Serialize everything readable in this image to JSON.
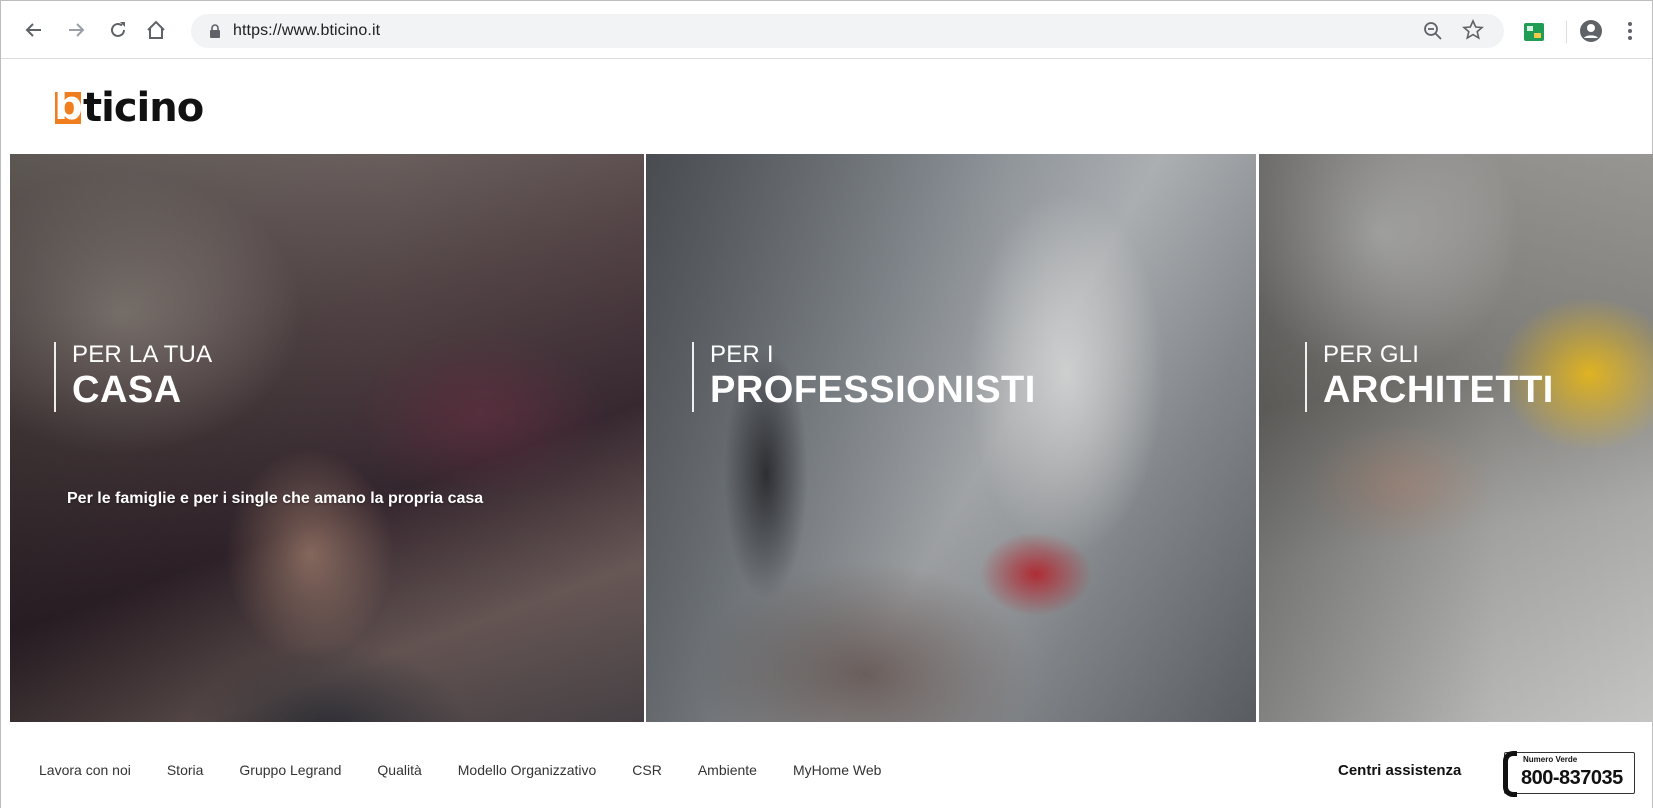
{
  "browser": {
    "url": "https://www.bticino.it",
    "icons": {
      "back": "arrow-left-icon",
      "forward": "arrow-right-icon",
      "reload": "reload-icon",
      "home": "home-icon",
      "lock": "lock-icon",
      "zoom": "zoom-icon",
      "bookmark": "star-icon",
      "extension": "extension-icon",
      "profile": "account-icon",
      "menu": "kebab-menu-icon"
    }
  },
  "site": {
    "logo_b": "b",
    "logo_rest": "ticino",
    "brand_color": "#f07d1e"
  },
  "hero": {
    "panels": [
      {
        "small": "PER LA TUA",
        "big": "CASA",
        "description": "Per le famiglie e per i single che amano la propria casa"
      },
      {
        "small": "PER I",
        "big": "PROFESSIONISTI"
      },
      {
        "small": "PER GLI",
        "big": "ARCHITETTI"
      }
    ]
  },
  "footer": {
    "links": [
      "Lavora con noi",
      "Storia",
      "Gruppo Legrand",
      "Qualità",
      "Modello Organizzativo",
      "CSR",
      "Ambiente",
      "MyHome Web"
    ],
    "centri": "Centri assistenza",
    "numero_label": "Numero Verde",
    "numero": "800-837035"
  }
}
